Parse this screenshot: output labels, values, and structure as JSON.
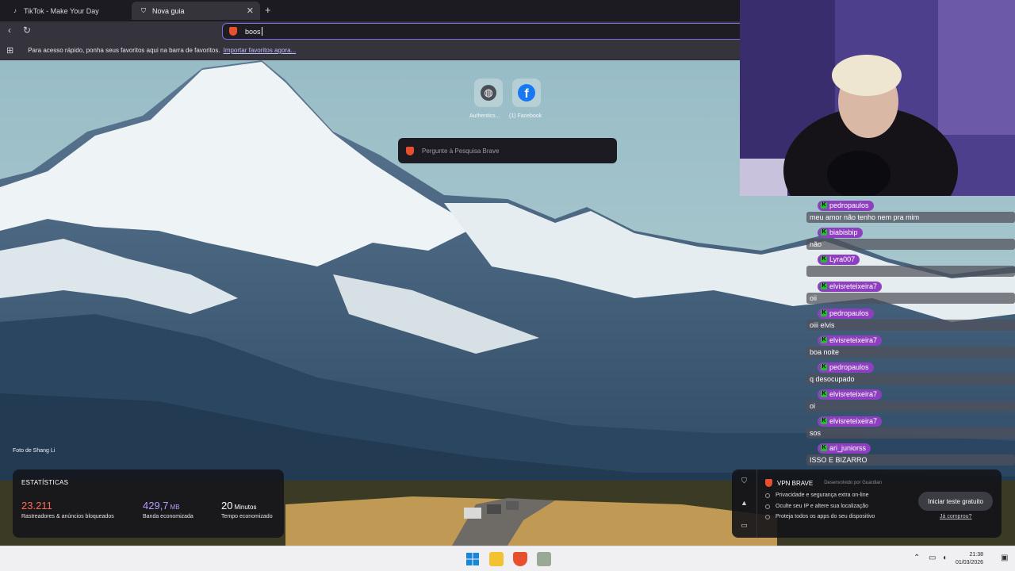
{
  "tabs": [
    {
      "title": "TikTok - Make Your Day",
      "icon": "tiktok-icon"
    },
    {
      "title": "Nova guia",
      "icon": "brave-shield-icon",
      "active": true
    }
  ],
  "address_bar": {
    "value": "boos"
  },
  "bookmarks_bar": {
    "message": "Para acesso rápido, ponha seus favoritos aqui na barra de favoritos.",
    "import_link": "Importar favoritos agora..."
  },
  "top_sites": [
    {
      "label": "Authentics...",
      "icon": "globe-icon"
    },
    {
      "label": "(1) Facebook",
      "icon": "facebook-icon"
    }
  ],
  "search": {
    "placeholder": "Pergunte à Pesquisa Brave"
  },
  "photo_credit": "Foto de Shang Li",
  "stats": {
    "title": "ESTATÍSTICAS",
    "trackers": {
      "value": "23.211",
      "label": "Rastreadores & anúncios bloqueados"
    },
    "bandwidth": {
      "value": "429,7",
      "unit": "MB",
      "label": "Banda economizada"
    },
    "time": {
      "value": "20",
      "unit": "Minutos",
      "label": "Tempo economizado"
    },
    "colors": {
      "trackers": "#ff6a5a",
      "bandwidth": "#b79cff",
      "time": "#ffffff"
    }
  },
  "vpn": {
    "title": "VPN BRAVE",
    "provider": "Desenvolvido por Guardian",
    "features": [
      "Privacidade e segurança extra on-line",
      "Oculte seu IP e altere sua localização",
      "Proteja todos os apps do seu dispositivo"
    ],
    "trial_button": "Iniciar teste gratuito",
    "bought_link": "Já comprou?"
  },
  "chat": [
    {
      "user": "pedropaulos",
      "text": "meu amor não tenho nem pra mim"
    },
    {
      "user": "biabisbip",
      "text": "não"
    },
    {
      "user": "Lyra007",
      "text": ""
    },
    {
      "user": "elvisreteixeira7",
      "text": "oii"
    },
    {
      "user": "pedropaulos",
      "text": "oiii elvis"
    },
    {
      "user": "elvisreteixeira7",
      "text": "boa noite"
    },
    {
      "user": "pedropaulos",
      "text": "q desocupado"
    },
    {
      "user": "elvisreteixeira7",
      "text": "oi"
    },
    {
      "user": "elvisreteixeira7",
      "text": "sos"
    },
    {
      "user": "ari_juniorss",
      "text": "ISSO E BIZARRO"
    }
  ],
  "taskbar": {
    "time": "21:38",
    "date": "01/03/2026"
  }
}
